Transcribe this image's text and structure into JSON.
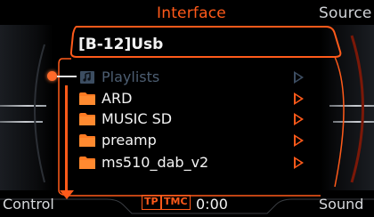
{
  "header": {
    "active_tab": "Interface",
    "right_tab": "Source"
  },
  "browser": {
    "path_title": "[B-12]Usb",
    "items": [
      {
        "label": "Playlists",
        "icon": "playlist-icon",
        "state": "disabled"
      },
      {
        "label": "ARD",
        "icon": "folder-icon",
        "state": "normal"
      },
      {
        "label": "MUSIC SD",
        "icon": "folder-icon",
        "state": "normal"
      },
      {
        "label": "preamp",
        "icon": "folder-icon",
        "state": "normal"
      },
      {
        "label": "ms510_dab_v2",
        "icon": "folder-icon",
        "state": "normal"
      }
    ]
  },
  "footer": {
    "left_label": "Control",
    "right_label": "Sound",
    "tp_badge": "TP",
    "tmc_badge": "TMC",
    "time": "0:00"
  },
  "colors": {
    "accent": "#ff5a1a",
    "disabled": "#4d5e72",
    "text": "#f4f4f4"
  }
}
